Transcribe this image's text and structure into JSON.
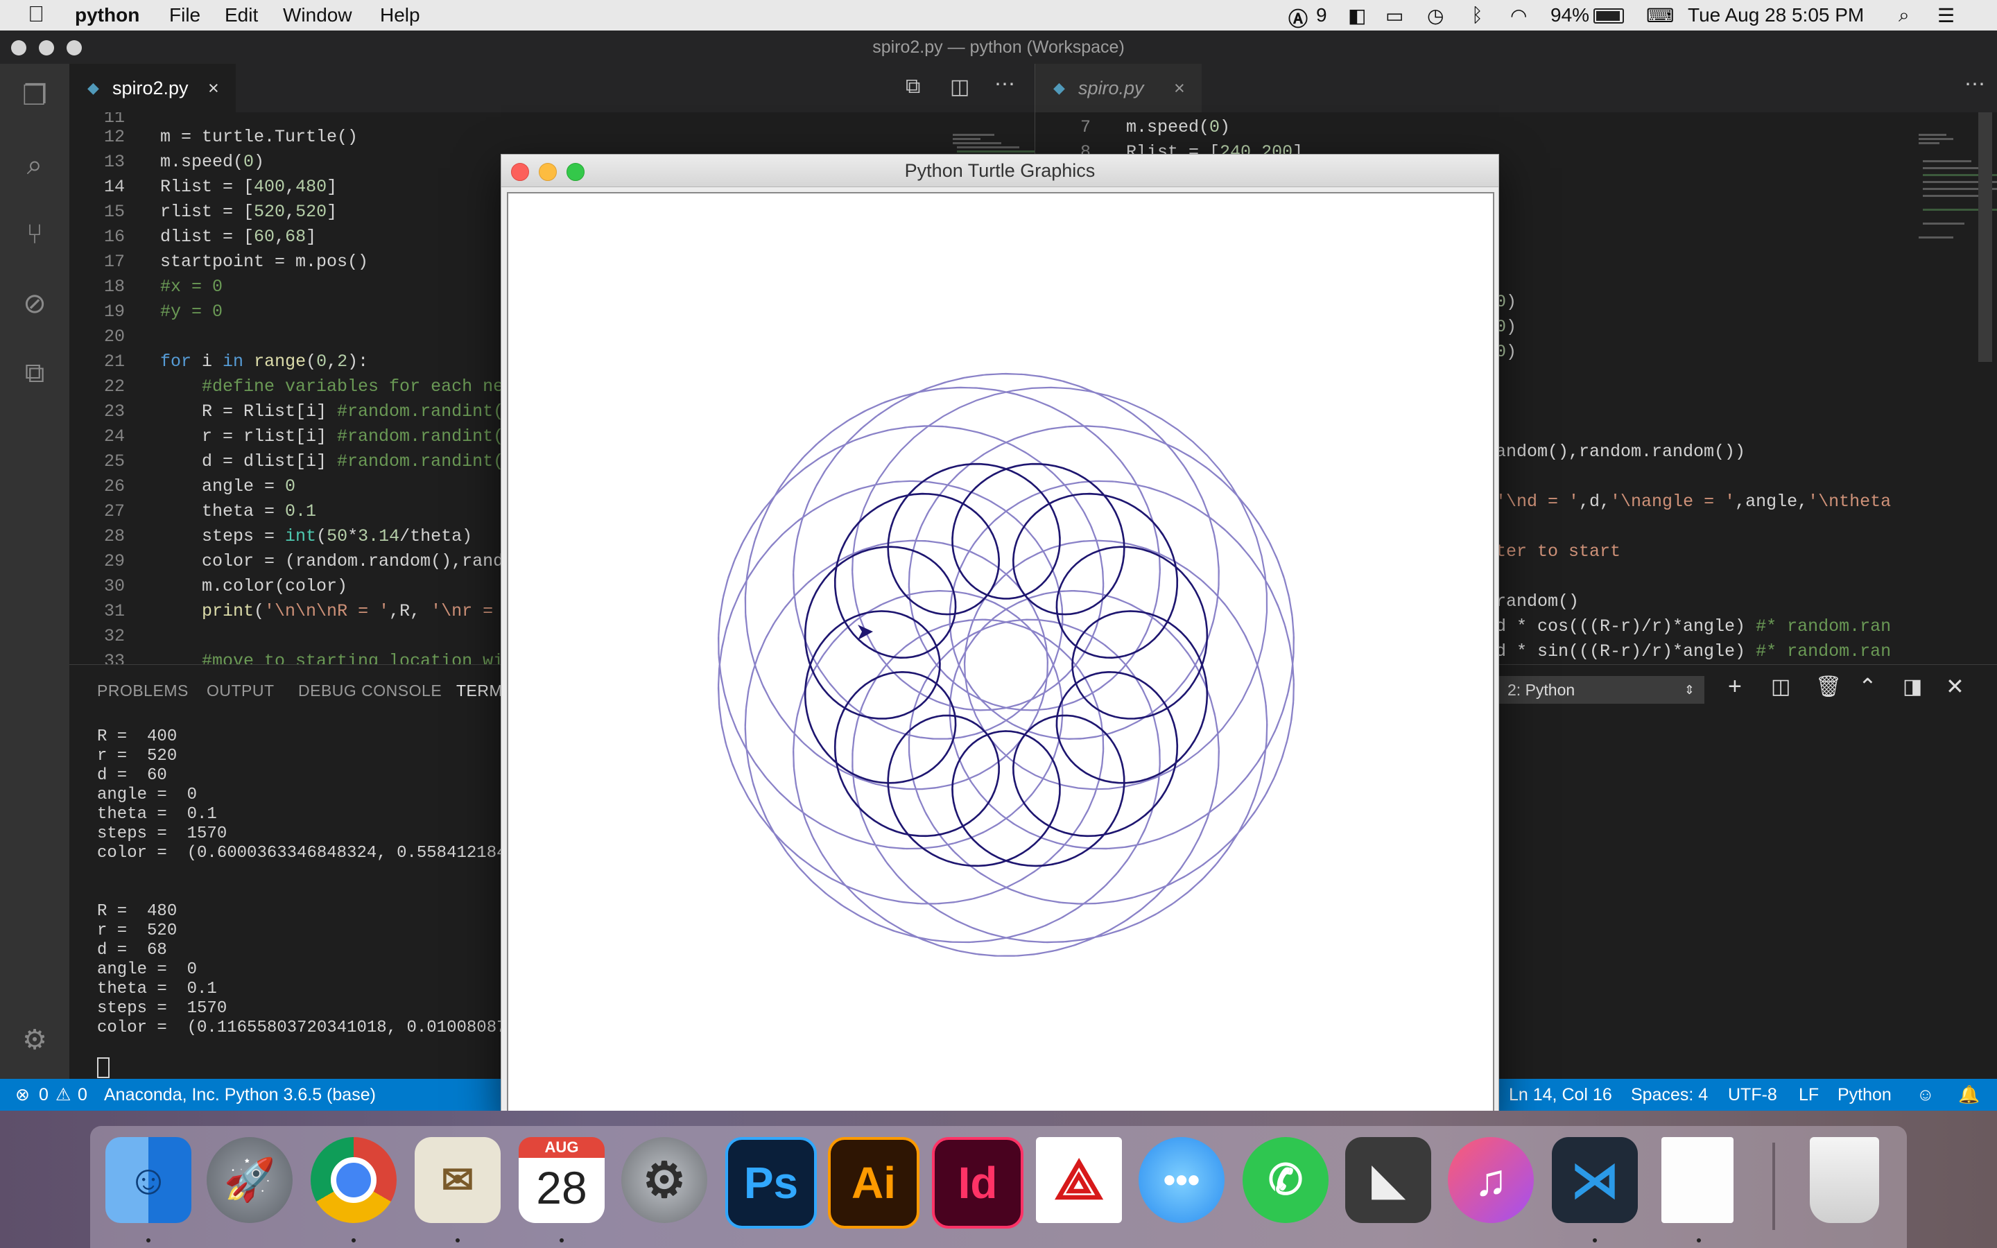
{
  "menubar": {
    "app": "python",
    "items": [
      "File",
      "Edit",
      "Window",
      "Help"
    ],
    "status": {
      "notif_count": "9",
      "battery": "94%",
      "datetime": "Tue Aug 28  5:05 PM"
    }
  },
  "window": {
    "title": "spiro2.py — python (Workspace)"
  },
  "left_editor": {
    "tab_label": "spiro2.py",
    "top_partial_line": "11",
    "lines": [
      {
        "n": "12",
        "t": [
          [
            "",
            "m = turtle.Turtle()"
          ]
        ]
      },
      {
        "n": "13",
        "t": [
          [
            "",
            "m.speed("
          ],
          [
            "num",
            "0"
          ],
          [
            "",
            ")"
          ]
        ]
      },
      {
        "n": "14",
        "t": [
          [
            "",
            "Rlist = ["
          ],
          [
            "num",
            "400"
          ],
          [
            "",
            ","
          ],
          [
            "num",
            "480"
          ],
          [
            "",
            "]"
          ]
        ]
      },
      {
        "n": "15",
        "t": [
          [
            "",
            "rlist = ["
          ],
          [
            "num",
            "520"
          ],
          [
            "",
            ","
          ],
          [
            "num",
            "520"
          ],
          [
            "",
            "]"
          ]
        ]
      },
      {
        "n": "16",
        "t": [
          [
            "",
            "dlist = ["
          ],
          [
            "num",
            "60"
          ],
          [
            "",
            ","
          ],
          [
            "num",
            "68"
          ],
          [
            "",
            "]"
          ]
        ]
      },
      {
        "n": "17",
        "t": [
          [
            "",
            "startpoint = m.pos()"
          ]
        ]
      },
      {
        "n": "18",
        "t": [
          [
            "cm",
            "#x = 0"
          ]
        ]
      },
      {
        "n": "19",
        "t": [
          [
            "cm",
            "#y = 0"
          ]
        ]
      },
      {
        "n": "20",
        "t": []
      },
      {
        "n": "21",
        "t": [
          [
            "kw",
            "for"
          ],
          [
            "",
            " i "
          ],
          [
            "kw",
            "in"
          ],
          [
            "",
            " "
          ],
          [
            "fn",
            "range"
          ],
          [
            "",
            "("
          ],
          [
            "num",
            "0"
          ],
          [
            "",
            ","
          ],
          [
            "num",
            "2"
          ],
          [
            "",
            "):"
          ]
        ]
      },
      {
        "n": "22",
        "t": [
          [
            "",
            "    "
          ],
          [
            "cm",
            "#define variables for each new"
          ]
        ]
      },
      {
        "n": "23",
        "t": [
          [
            "",
            "    R = Rlist[i] "
          ],
          [
            "cm",
            "#random.randint(0"
          ]
        ]
      },
      {
        "n": "24",
        "t": [
          [
            "",
            "    r = rlist[i] "
          ],
          [
            "cm",
            "#random.randint(0"
          ]
        ]
      },
      {
        "n": "25",
        "t": [
          [
            "",
            "    d = dlist[i] "
          ],
          [
            "cm",
            "#random.randint(0"
          ]
        ]
      },
      {
        "n": "26",
        "t": [
          [
            "",
            "    angle = "
          ],
          [
            "num",
            "0"
          ]
        ]
      },
      {
        "n": "27",
        "t": [
          [
            "",
            "    theta = "
          ],
          [
            "num",
            "0.1"
          ]
        ]
      },
      {
        "n": "28",
        "t": [
          [
            "",
            "    steps = "
          ],
          [
            "bi",
            "int"
          ],
          [
            "",
            "("
          ],
          [
            "num",
            "50"
          ],
          [
            "",
            "*"
          ],
          [
            "num",
            "3.14"
          ],
          [
            "",
            "/theta)"
          ]
        ]
      },
      {
        "n": "29",
        "t": [
          [
            "",
            "    color = (random.random(),rando"
          ]
        ]
      },
      {
        "n": "30",
        "t": [
          [
            "",
            "    m.color(color)"
          ]
        ]
      },
      {
        "n": "31",
        "t": [
          [
            "",
            "    "
          ],
          [
            "fn",
            "print"
          ],
          [
            "",
            "("
          ],
          [
            "str",
            "'\\n\\n\\nR = '"
          ],
          [
            "",
            ",R, "
          ],
          [
            "str",
            "'\\nr = '"
          ]
        ]
      },
      {
        "n": "32",
        "t": []
      },
      {
        "n": "33",
        "t": [
          [
            "",
            "    "
          ],
          [
            "cm",
            "#move to starting location wit"
          ]
        ]
      }
    ]
  },
  "right_editor": {
    "tab_label": "spiro.py",
    "lines": [
      {
        "n": "7",
        "t": [
          [
            "",
            "m.speed("
          ],
          [
            "num",
            "0"
          ],
          [
            "",
            ")"
          ]
        ]
      },
      {
        "n": "8",
        "t": [
          [
            "",
            "Rlist = ["
          ],
          [
            "num",
            "240"
          ],
          [
            "",
            ","
          ],
          [
            "num",
            "200"
          ],
          [
            "",
            "]"
          ]
        ]
      }
    ],
    "fragments": [
      {
        "row": 7,
        "t": [
          [
            "num",
            "0"
          ],
          [
            "",
            ")"
          ]
        ]
      },
      {
        "row": 8,
        "t": [
          [
            "num",
            "0"
          ],
          [
            "",
            ")"
          ]
        ]
      },
      {
        "row": 9,
        "t": [
          [
            "num",
            "0"
          ],
          [
            "",
            ")"
          ]
        ]
      },
      {
        "row": 13,
        "t": [
          [
            "",
            "andom(),random.random())"
          ]
        ]
      },
      {
        "row": 15,
        "t": [
          [
            "str",
            "'\\nd = '"
          ],
          [
            "",
            ",d,"
          ],
          [
            "str",
            "'\\nangle = '"
          ],
          [
            "",
            ",angle,"
          ],
          [
            "str",
            "'\\ntheta"
          ]
        ]
      },
      {
        "row": 17,
        "t": [
          [
            "str",
            "ter to start"
          ]
        ]
      },
      {
        "row": 19,
        "t": [
          [
            "",
            "random()"
          ]
        ]
      },
      {
        "row": 20,
        "t": [
          [
            "",
            "d * cos(((R-r)/r)*angle) "
          ],
          [
            "cm",
            "#* random.ran"
          ]
        ]
      },
      {
        "row": 21,
        "t": [
          [
            "",
            "d * sin(((R-r)/r)*angle) "
          ],
          [
            "cm",
            "#* random.ran"
          ]
        ]
      }
    ]
  },
  "panel": {
    "tabs": [
      "PROBLEMS",
      "OUTPUT",
      "DEBUG CONSOLE",
      "TERM"
    ],
    "terminal_select": "2: Python",
    "terminal_lines": [
      "R =  400",
      "r =  520",
      "d =  60",
      "angle =  0",
      "theta =  0.1",
      "steps =  1570",
      "color =  (0.6000363346848324, 0.558412184",
      "",
      "",
      "R =  480",
      "r =  520",
      "d =  68",
      "angle =  0",
      "theta =  0.1",
      "steps =  1570",
      "color =  (0.11655803720341018, 0.01008087"
    ]
  },
  "turtle_window": {
    "title": "Python Turtle Graphics",
    "spiro_outer": {
      "R": 400,
      "r": 520,
      "d": 60,
      "color": "#8a82c8"
    },
    "spiro_inner": {
      "R": 480,
      "r": 520,
      "d": 68,
      "color": "#1e1670"
    }
  },
  "statusbar": {
    "errors": "0",
    "warnings": "0",
    "interpreter": "Anaconda, Inc. Python 3.6.5 (base)",
    "position": "Ln 14, Col 16",
    "spaces": "Spaces: 4",
    "encoding": "UTF-8",
    "eol": "LF",
    "language": "Python"
  },
  "dock": {
    "calendar_month": "AUG",
    "calendar_day": "28",
    "ps": "Ps",
    "ai": "Ai",
    "id": "Id"
  }
}
